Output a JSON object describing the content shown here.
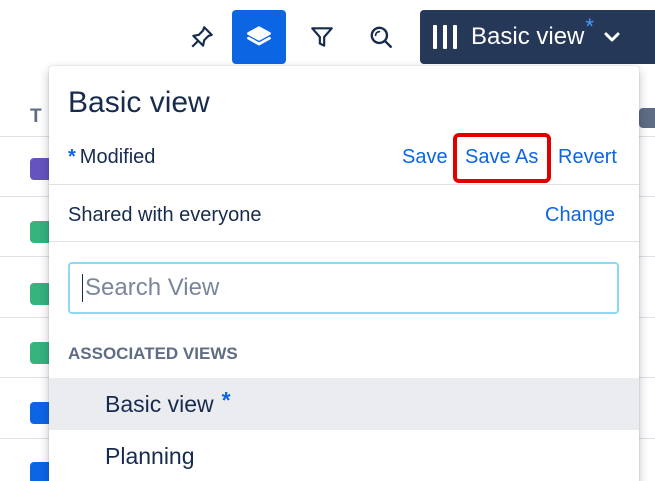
{
  "toolbar": {
    "icons": [
      "pin-icon",
      "layers-icon",
      "filter-icon",
      "search-icon"
    ],
    "view_button": {
      "label": "Basic view",
      "modified_star": "*"
    }
  },
  "background": {
    "column_header": "T"
  },
  "dropdown": {
    "title": "Basic view",
    "modified_star": "*",
    "modified_label": "Modified",
    "save_label": "Save",
    "save_as_label": "Save As",
    "revert_label": "Revert",
    "shared_label": "Shared with everyone",
    "change_label": "Change",
    "search_placeholder": "Search View",
    "section_label": "ASSOCIATED VIEWS",
    "views": [
      {
        "label": "Basic view",
        "star": "*",
        "selected": true
      },
      {
        "label": "Planning",
        "star": "",
        "selected": false
      }
    ]
  },
  "colors": {
    "accent": "#0c66e4",
    "view_button_bg": "#253858",
    "highlight": "#e00000",
    "selected_bg": "#ebecf0"
  }
}
